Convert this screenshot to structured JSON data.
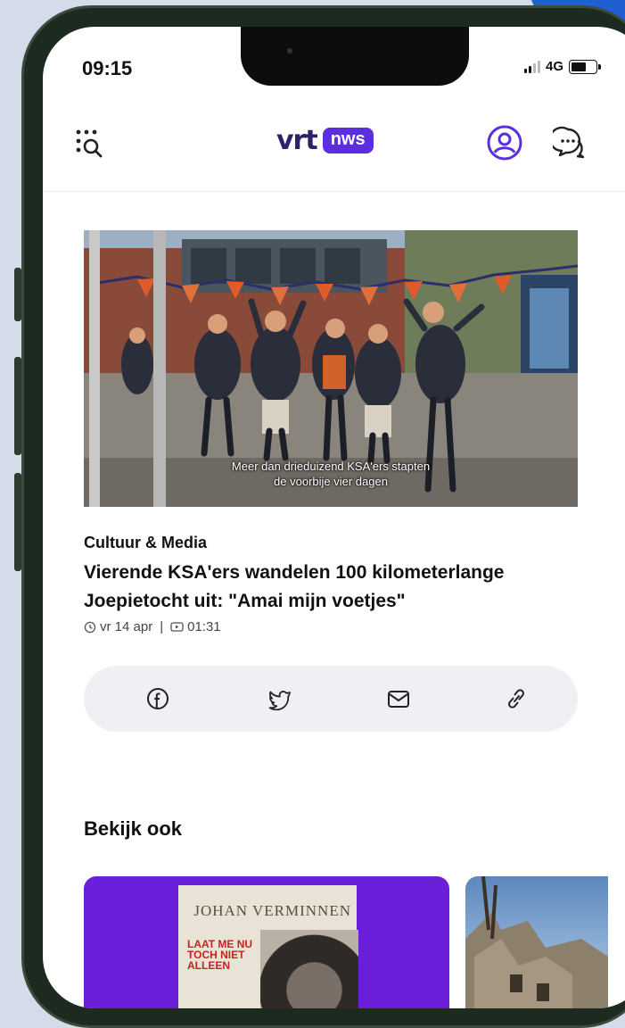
{
  "status_bar": {
    "time": "09:15",
    "network": "4G"
  },
  "app_bar": {
    "logo_text": "vrt",
    "logo_badge": "nws",
    "icons": [
      "search-icon",
      "profile-icon",
      "chat-icon"
    ],
    "accent_color": "#5b2ee0"
  },
  "article": {
    "video_caption_line1": "Meer dan drieduizend KSA'ers stapten",
    "video_caption_line2": "de voorbije vier dagen",
    "category": "Cultuur & Media",
    "headline": "Vierende KSA'ers wandelen 100 kilometerlange Joepietocht uit: \"Amai mijn voetjes\"",
    "date": "vr 14 apr",
    "separator": "|",
    "duration": "01:31"
  },
  "share": {
    "buttons": [
      "facebook-icon",
      "twitter-icon",
      "mail-icon",
      "link-icon"
    ]
  },
  "see_also": {
    "title": "Bekijk ook",
    "cards": [
      {
        "album_artist": "JOHAN VERMINNEN",
        "album_title": "LAAT ME NU TOCH NIET ALLEEN"
      },
      {
        "image": "ruins-photo"
      }
    ]
  }
}
